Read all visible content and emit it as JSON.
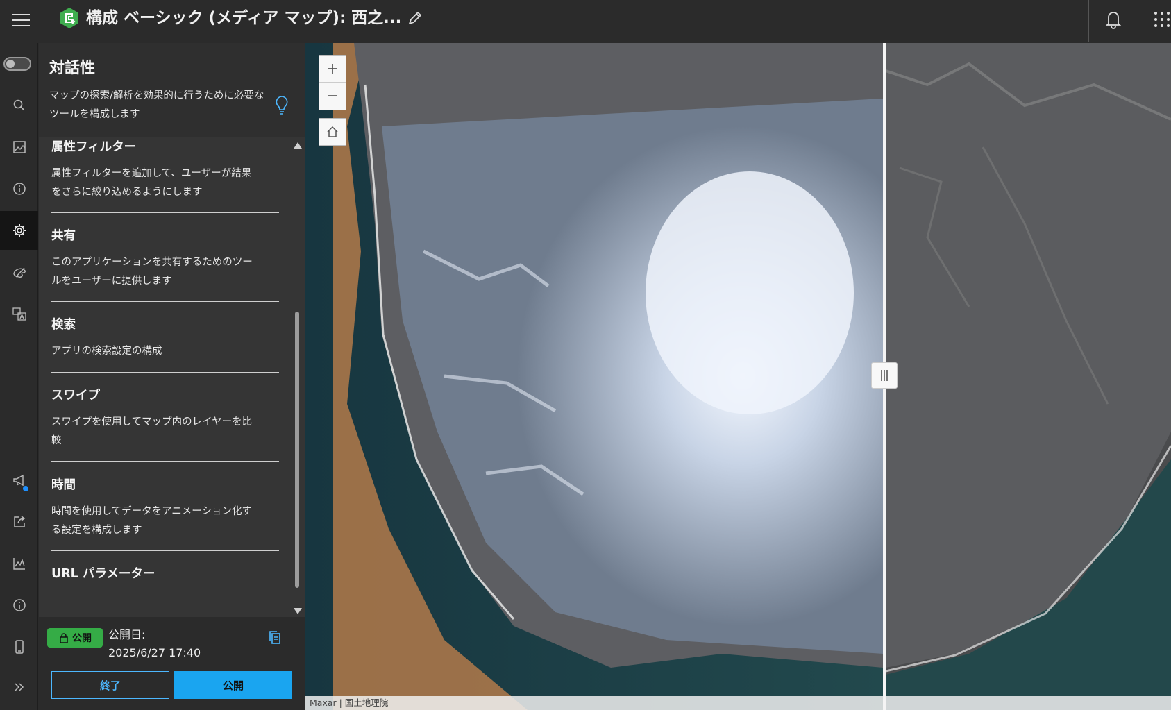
{
  "header": {
    "title": "構成 ベーシック (メディア マップ): 西之...",
    "brand_color": "#3fae4f"
  },
  "rail": {
    "items": [
      "toggle",
      "search-icon",
      "image-icon",
      "info-icon",
      "gear-icon",
      "theme-icon",
      "language-icon",
      "megaphone-icon",
      "share-icon",
      "chart-icon",
      "info-icon",
      "mobile-icon",
      "expand-icon"
    ],
    "active": "gear-icon"
  },
  "panel": {
    "title": "対話性",
    "description": "マップの探索/解析を効果的に行うために必要なツールを構成します",
    "sections": [
      {
        "title": "属性フィルター",
        "description": "属性フィルターを追加して、ユーザーが結果をさらに絞り込めるようにします"
      },
      {
        "title": "共有",
        "description": "このアプリケーションを共有するためのツールをユーザーに提供します"
      },
      {
        "title": "検索",
        "description": "アプリの検索設定の構成"
      },
      {
        "title": "スワイプ",
        "description": "スワイプを使用してマップ内のレイヤーを比較"
      },
      {
        "title": "時間",
        "description": "時間を使用してデータをアニメーション化する設定を構成します"
      },
      {
        "title": "URL パラメーター",
        "description": ""
      }
    ]
  },
  "footer": {
    "badge_label": "公開",
    "publish_date_label": "公開日:",
    "publish_date": "2025/6/27 17:40",
    "exit_label": "終了",
    "publish_label": "公開",
    "accent_color": "#1aa5f0"
  },
  "map": {
    "zoom_in": "+",
    "zoom_out": "−",
    "attribution": "Maxar | 国土地理院"
  }
}
